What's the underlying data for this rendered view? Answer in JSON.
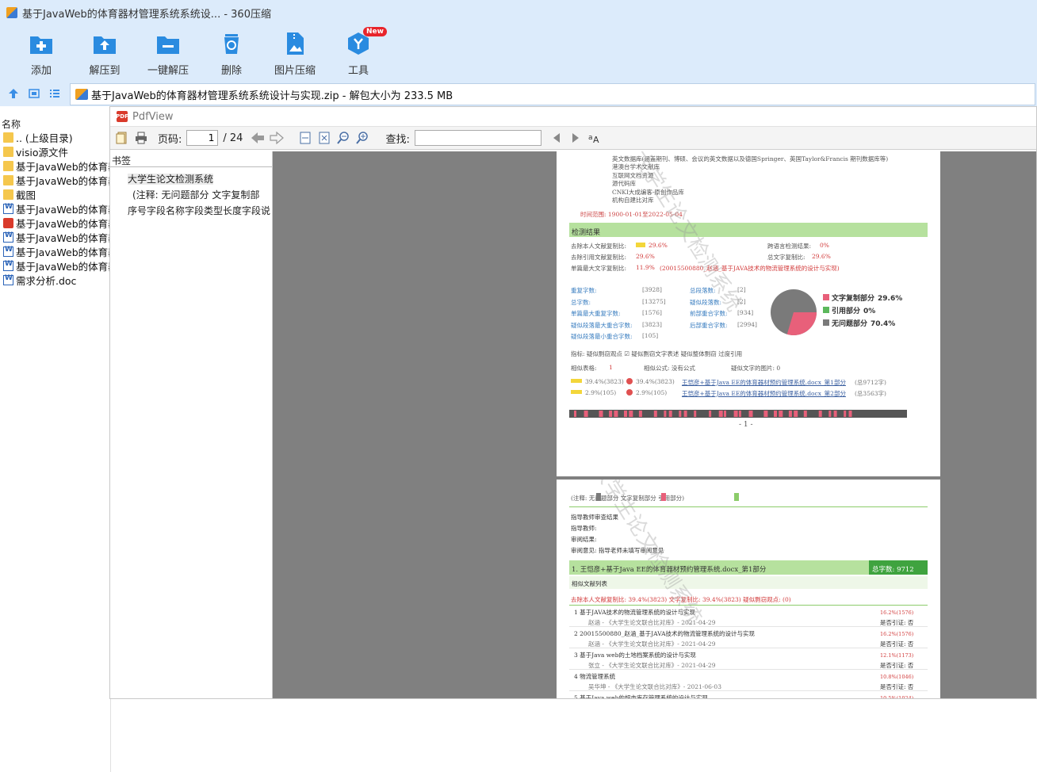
{
  "window": {
    "title": "基于JavaWeb的体育器材管理系统系统设... - 360压缩"
  },
  "toolbar": {
    "add": "添加",
    "extract_to": "解压到",
    "one_click": "一键解压",
    "delete": "删除",
    "image_compress": "图片压缩",
    "tools": "工具",
    "new_badge": "New"
  },
  "address": {
    "path": "基于JavaWeb的体育器材管理系统系统设计与实现.zip - 解包大小为 233.5 MB"
  },
  "filelist": {
    "header": "名称",
    "items": [
      {
        "name": ".. (上级目录)",
        "type": "folder"
      },
      {
        "name": "visio源文件",
        "type": "folder"
      },
      {
        "name": "基于JavaWeb的体育器",
        "type": "folder"
      },
      {
        "name": "基于JavaWeb的体育器",
        "type": "folder"
      },
      {
        "name": "截图",
        "type": "folder"
      },
      {
        "name": "基于JavaWeb的体育器",
        "type": "word"
      },
      {
        "name": "基于JavaWeb的体育器",
        "type": "pdf"
      },
      {
        "name": "基于JavaWeb的体育器",
        "type": "word"
      },
      {
        "name": "基于JavaWeb的体育器",
        "type": "word"
      },
      {
        "name": "基于JavaWeb的体育器",
        "type": "word"
      },
      {
        "name": "需求分析.doc",
        "type": "word"
      }
    ]
  },
  "pdfview": {
    "title": "PdfView",
    "page_label": "页码:",
    "page_current": "1",
    "page_total": "/ 24",
    "find_label": "查找:",
    "bookmarks_head": "书签",
    "bookmarks": [
      "大学生论文检测系统",
      "(注释:  无问题部分 文字复制部",
      "序号字段名称字段类型长度字段说"
    ]
  },
  "page1": {
    "db_lines": [
      "英文数据库(涵盖期刊、博硕、会议的英文数据以及德国Springer、英国Taylor&Francis 期刊数据库等)",
      "港澳台学术文献库",
      "互联网文档资源",
      "源代码库",
      "CNKI大成编客-原创作品库",
      "机构自建比对库"
    ],
    "time_range": "时间范围: 1900-01-01至2022-05-04",
    "section": "检测结果",
    "r1a": "去除本人文献复制比:",
    "r1a_v": "29.6%",
    "r1b": "跨语言检测结果:",
    "r1b_v": "0%",
    "r2a": "去除引用文献复制比:",
    "r2a_v": "29.6%",
    "r2b": "总文字复制比:",
    "r2b_v": "29.6%",
    "r3a": "单篇最大文字复制比:",
    "r3a_v": "11.9%",
    "r3a_note": "(20015500880_赵涵_基于JAVA技术的物流管理系统的设计与实现)",
    "stats": [
      {
        "k": "重复字数:",
        "v": "[3928]",
        "k2": "总段落数:",
        "v2": "[2]"
      },
      {
        "k": "总字数:",
        "v": "[13275]",
        "k2": "疑似段落数:",
        "v2": "[2]"
      },
      {
        "k": "单篇最大重复字数:",
        "v": "[1576]",
        "k2": "前部重合字数:",
        "v2": "[934]"
      },
      {
        "k": "疑似段落最大重合字数:",
        "v": "[3823]",
        "k2": "后部重合字数:",
        "v2": "[2994]"
      },
      {
        "k": "疑似段落最小重合字数:",
        "v": "[105]",
        "k2": "",
        "v2": ""
      }
    ],
    "legend": [
      {
        "label": "文字复制部分",
        "value": "29.6%",
        "color": "#e8607a"
      },
      {
        "label": "引用部分",
        "value": "0%",
        "color": "#5cb85c"
      },
      {
        "label": "无问题部分",
        "value": "70.4%",
        "color": "#7a7a7a"
      }
    ],
    "indicators": "指标:    疑似剽窃观点    ☑ 疑似剽窃文字表述    疑似整体剽窃    过度引用",
    "sim_table": "相似表格:",
    "sim_table_v": "1",
    "sim_formula": "相似公式:  没有公式",
    "sim_image": "疑似文字的图片:  0",
    "part_rows": [
      {
        "a": "39.4%(3823)",
        "b": "39.4%(3823)",
        "name": "王恺彦+基于Java EE的体育器材预约管理系统.docx_第1部分",
        "total": "(总9712字)"
      },
      {
        "a": "2.9%(105)",
        "b": "2.9%(105)",
        "name": "王恺彦+基于Java EE的体育器材预约管理系统.docx_第2部分",
        "total": "(总3563字)"
      }
    ],
    "page_num": "- 1 -"
  },
  "page2": {
    "note": "(注释:    无问题部分          文字复制部分          引用部分)",
    "review_title": "指导教师审查结果",
    "reviewer": "指导教师:",
    "review_result": "审阅结果:",
    "review_comment": "审阅意见:    指导老师未填写审阅意见",
    "part_title": "1. 王恺彦+基于Java EE的体育器材预约管理系统.docx_第1部分",
    "part_total": "总字数: 9712",
    "similar_list": "相似文献列表",
    "ratio_line": "去除本人文献复制比:   39.4%(3823)          文字复制比:   39.4%(3823)          疑似剽窃观点: (0)",
    "refs": [
      {
        "title": "1 基于JAVA技术的物流管理系统的设计与实现",
        "pct": "16.2%(1576)",
        "src": "赵涵 - 《大学生论文联合比对库》- 2021-04-29",
        "cite": "是否引证: 否"
      },
      {
        "title": "2 20015500880_赵涵_基于JAVA技术的物流管理系统的设计与实现",
        "pct": "16.2%(1576)",
        "src": "赵涵 - 《大学生论文联合比对库》- 2021-04-29",
        "cite": "是否引证: 否"
      },
      {
        "title": "3 基于Java web的土地档案系统的设计与实现",
        "pct": "12.1%(1173)",
        "src": "张立 - 《大学生论文联合比对库》- 2021-04-29",
        "cite": "是否引证: 否"
      },
      {
        "title": "4 物流管理系统",
        "pct": "10.8%(1046)",
        "src": "吴华坤 - 《大学生论文联合比对库》- 2021-06-03",
        "cite": "是否引证: 否"
      },
      {
        "title": "5 基于Java web的超市库存管理系统的设计与实现",
        "pct": "10.5%(1024)",
        "src": "",
        "cite": ""
      }
    ]
  },
  "watermark": "大学生论文检测系统"
}
